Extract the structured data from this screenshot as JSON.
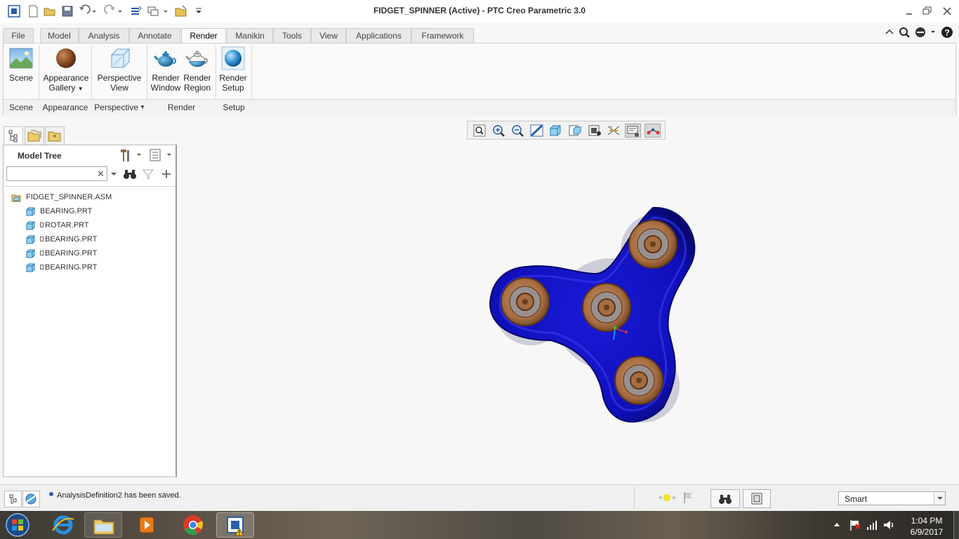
{
  "window": {
    "title": "FIDGET_SPINNER (Active) - PTC Creo Parametric 3.0"
  },
  "ribbon": {
    "file_label": "File",
    "tabs": [
      "Model",
      "Analysis",
      "Annotate",
      "Render",
      "Manikin",
      "Tools",
      "View",
      "Applications",
      "Framework"
    ],
    "active_tab": "Render",
    "buttons": {
      "scene": "Scene",
      "appearance_gallery_1": "Appearance",
      "appearance_gallery_2": "Gallery",
      "perspective_view_1": "Perspective",
      "perspective_view_2": "View",
      "render_window_1": "Render",
      "render_window_2": "Window",
      "render_region_1": "Render",
      "render_region_2": "Region",
      "render_setup_1": "Render",
      "render_setup_2": "Setup"
    },
    "groups": [
      "Scene",
      "Appearance",
      "Perspective",
      "Render",
      "Setup"
    ]
  },
  "model_tree": {
    "title": "Model Tree",
    "search_value": "",
    "items": [
      {
        "label": "FIDGET_SPINNER.ASM",
        "type": "assembly-icon"
      },
      {
        "label": "BEARING.PRT",
        "type": "part-icon"
      },
      {
        "label": "ROTAR.PRT",
        "type": "part-icon"
      },
      {
        "label": "BEARING.PRT",
        "type": "part-icon"
      },
      {
        "label": "BEARING.PRT",
        "type": "part-icon"
      },
      {
        "label": "BEARING.PRT",
        "type": "part-icon"
      }
    ]
  },
  "status": {
    "message": "AnalysisDefinition2 has been saved.",
    "filter": "Smart"
  },
  "taskbar": {
    "time": "1:04 PM",
    "date": "6/9/2017"
  },
  "colors": {
    "spinner_body": "#1c1ccf",
    "bearing": "#b07a4e",
    "ribbon_bg": "#fafafa"
  }
}
